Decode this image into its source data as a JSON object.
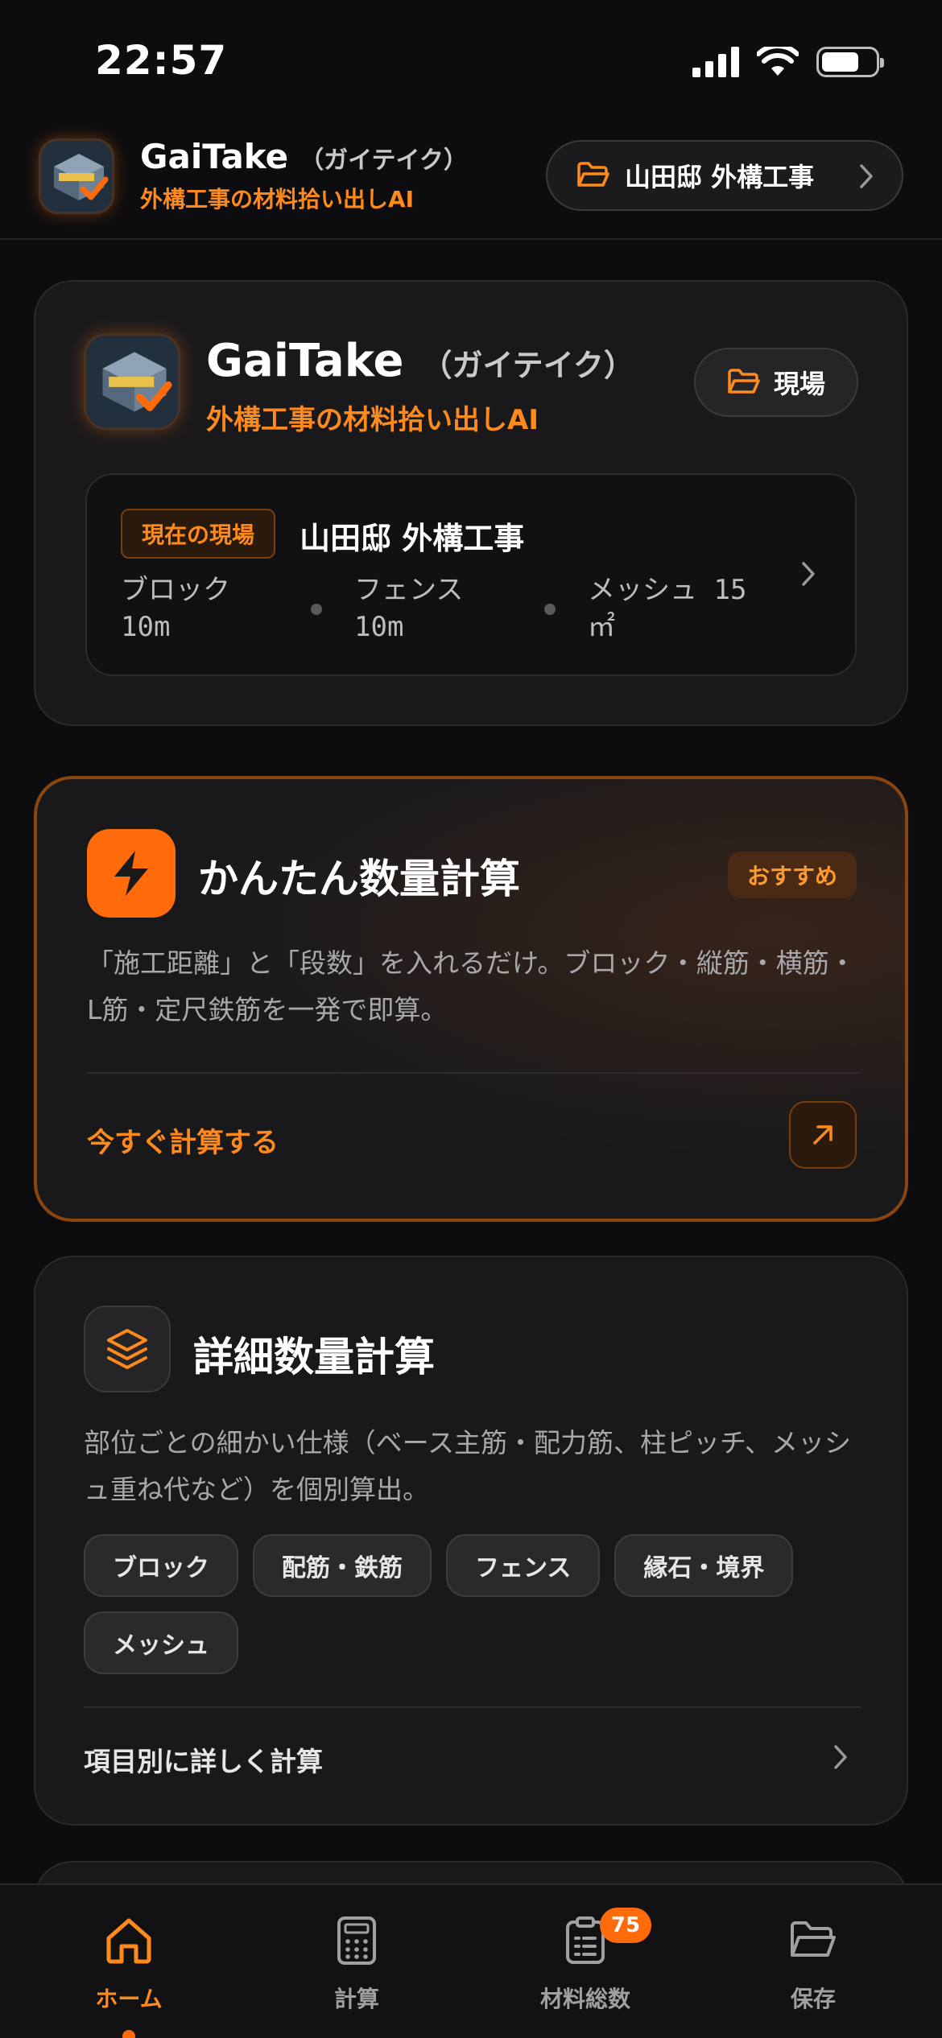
{
  "status": {
    "time": "22:57"
  },
  "header": {
    "app_name": "GaiTake",
    "app_kana": "（ガイテイク）",
    "tagline": "外構工事の材料拾い出しAI",
    "site_label": "山田邸 外構工事"
  },
  "hero": {
    "app_name": "GaiTake",
    "app_kana": "（ガイテイク）",
    "tagline": "外構工事の材料拾い出しAI",
    "site_button": "現場",
    "current_badge": "現在の現場",
    "current_site": "山田邸 外構工事",
    "stats": [
      {
        "label": "ブロック",
        "value": "10m"
      },
      {
        "label": "フェンス",
        "value": "10m"
      },
      {
        "label": "メッシュ 15",
        "value": "㎡"
      }
    ]
  },
  "quick": {
    "title": "かんたん数量計算",
    "badge": "おすすめ",
    "desc": "「施工距離」と「段数」を入れるだけ。ブロック・縦筋・横筋・L筋・定尺鉄筋を一発で即算。",
    "action": "今すぐ計算する"
  },
  "detail": {
    "title": "詳細数量計算",
    "desc": "部位ごとの細かい仕様（ベース主筋・配力筋、柱ピッチ、メッシュ重ね代など）を個別算出。",
    "chips": [
      "ブロック",
      "配筋・鉄筋",
      "フェンス",
      "縁石・境界",
      "メッシュ"
    ],
    "action": "項目別に詳しく計算"
  },
  "tabs": [
    {
      "label": "ホーム",
      "icon": "home-icon"
    },
    {
      "label": "計算",
      "icon": "calculator-icon"
    },
    {
      "label": "材料総数",
      "icon": "clipboard-list-icon",
      "badge": "75"
    },
    {
      "label": "保存",
      "icon": "folder-open-icon"
    }
  ],
  "colors": {
    "accent": "#ff6a0a",
    "accent_text": "#ff8a1c",
    "background": "#0d0d0f",
    "card": "#19191c"
  }
}
